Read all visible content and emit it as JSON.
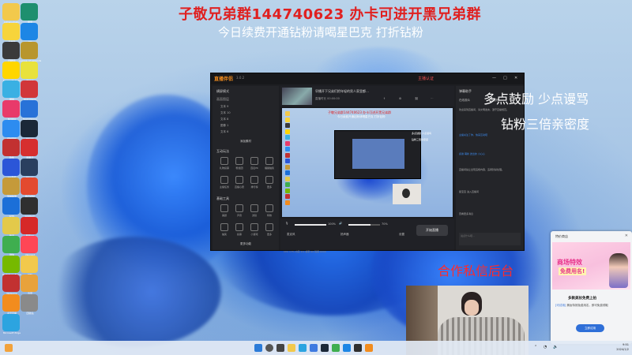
{
  "banner": {
    "line1": "子敬兄弟群144740623 办卡可进开黑兄弟群",
    "line2": "今日续费开通钻粉请喝星巴克 打折钻粉"
  },
  "overlay": {
    "text1": "多点鼓励 少点谩骂",
    "text2": "钻粉三倍亲密度",
    "text3": "合作私信后台"
  },
  "desktop_icons": [
    {
      "label": "Administrator",
      "color": "#f2c94c"
    },
    {
      "label": "此电脑",
      "color": "#f7d43b"
    },
    {
      "label": "回收站",
      "color": "#3a3a3a"
    },
    {
      "label": "Microsoft Edge",
      "color": "#ffd600"
    },
    {
      "label": "网络",
      "color": "#3ab0e3"
    },
    {
      "label": "NVIDIA",
      "color": "#e83a6a"
    },
    {
      "label": "控制面板",
      "color": "#2d8cf0"
    },
    {
      "label": "软件",
      "color": "#c23131"
    },
    {
      "label": "QQ音乐",
      "color": "#2b56d8"
    },
    {
      "label": "英雄联盟",
      "color": "#c59a3a"
    },
    {
      "label": "WPS",
      "color": "#1b6fd8"
    },
    {
      "label": "腾讯",
      "color": "#e3c94a"
    },
    {
      "label": "微信",
      "color": "#3fae4f"
    },
    {
      "label": "NVIDIA GeForce",
      "color": "#76b900"
    },
    {
      "label": "WeGame",
      "color": "#c23131"
    },
    {
      "label": "虎牙直播",
      "color": "#f28c1e"
    },
    {
      "label": "Microsoft Edge",
      "color": "#2ca4e0"
    },
    {
      "label": "夸克",
      "color": "#1e8f6e"
    },
    {
      "label": "QQ",
      "color": "#1d86e5"
    },
    {
      "label": "League of Legends",
      "color": "#b8962e"
    },
    {
      "label": "Bilibili",
      "color": "#e8e23b"
    },
    {
      "label": "Riot Client",
      "color": "#d13639"
    },
    {
      "label": "TeamViewer",
      "color": "#2872d8"
    },
    {
      "label": "Steam",
      "color": "#1b2838"
    },
    {
      "label": "网易云",
      "color": "#d62f2f"
    },
    {
      "label": "Steam",
      "color": "#2a3f5f"
    },
    {
      "label": "腾讯视频",
      "color": "#e34a2f"
    },
    {
      "label": "Logitech",
      "color": "#2f2f2f"
    },
    {
      "label": "网易UU",
      "color": "#d62828"
    },
    {
      "label": "Valorant",
      "color": "#ff4655"
    },
    {
      "label": "OBS",
      "color": "#f2c94c"
    },
    {
      "label": "迅雷",
      "color": "#e8a23b"
    },
    {
      "label": "回收站",
      "color": "#8a8a8a"
    }
  ],
  "app": {
    "logo": "直播伴侣",
    "version": "3.0.2",
    "title_right": "主播认证",
    "left_panel": {
      "scene_mode": "横屏模式",
      "source_heading": "画面图层",
      "sources": [
        "文本 9",
        "文本 10",
        "文本 8",
        "图像 1",
        "文本 6"
      ],
      "add_source": "添加素材",
      "interaction_heading": "互动玩法",
      "interaction_tools": [
        "礼物投票",
        "粉丝团",
        "连麦PK",
        "福袋抽奖",
        "主播任务",
        "直播心愿",
        "排行榜",
        "更多"
      ],
      "basic_heading": "基础工具",
      "basic_tools": [
        "美颜",
        "声音",
        "滤镜",
        "特效",
        "抽奖",
        "投票",
        "小游戏",
        "更多"
      ],
      "more_button": "更多功能"
    },
    "center": {
      "stream_title": "早播开下兄弟们把年轻的男人家里都…",
      "stream_sub": "直播时长 00:00:00",
      "controls": {
        "mic_label": "麦克风",
        "mic_value": "100%",
        "speaker_label": "扬声器",
        "speaker_value": "70%",
        "settings_label": "设置",
        "go_live": "开始直播"
      },
      "status": "CPU 17%  内存 4%  帧率 60  码率 6000"
    },
    "right_panel": {
      "heading": "弹幕助手",
      "tabs": [
        "在线观众",
        "贡献榜"
      ],
      "messages": [
        "欢迎来到直播间，请文明发言，遵守直播规范。",
        "主播关注了你，快来互动吧",
        "感谢 萌新 送出的 小心心",
        "直播间禁止出现违规内容，违者封禁处理。",
        "星宝宝 进入直播间",
        "查看更多消息"
      ],
      "input_placeholder": "说点什么吧..."
    }
  },
  "ad_panel": {
    "header": "特价商店",
    "headline1": "商场特效",
    "headline2": "免费用名!",
    "title": "多款美妆免费上拍",
    "body_link": "[可试用]",
    "body": "美妆特效免费用名，即可免费领取",
    "cta": "立即试用"
  },
  "taskbar": {
    "time": "9:51",
    "date": "2024/1/2"
  }
}
